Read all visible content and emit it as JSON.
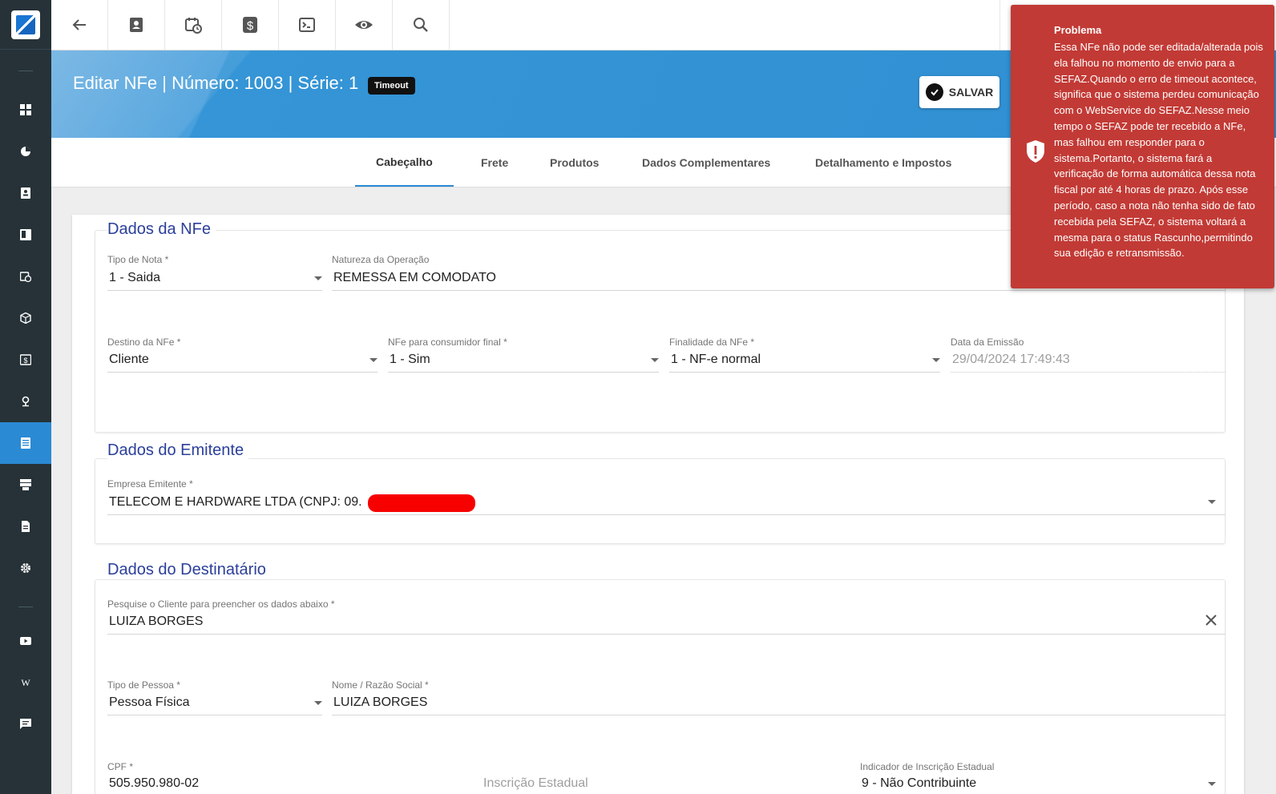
{
  "toolbar": {
    "buttons": [
      "back-arrow-icon",
      "contact-card-icon",
      "calendar-clock-icon",
      "dollar-icon",
      "terminal-icon",
      "eye-icon",
      "search-icon"
    ]
  },
  "header": {
    "title": "Editar NFe | Número: 1003 | Série: 1",
    "badge": "Timeout",
    "save_label": "SALVAR"
  },
  "tabs": [
    {
      "label": "Cabeçalho",
      "active": true
    },
    {
      "label": "Frete"
    },
    {
      "label": "Produtos"
    },
    {
      "label": "Dados Complementares"
    },
    {
      "label": "Detalhamento e Impostos"
    }
  ],
  "sections": {
    "nfe": {
      "title": "Dados da NFe",
      "tipo_nota": {
        "label": "Tipo de Nota *",
        "value": "1 - Saida"
      },
      "natureza": {
        "label": "Natureza da Operação",
        "value": "REMESSA EM COMODATO"
      },
      "destino": {
        "label": "Destino da NFe *",
        "value": "Cliente"
      },
      "consumidor": {
        "label": "NFe para consumidor final *",
        "value": "1 - Sim"
      },
      "finalidade": {
        "label": "Finalidade da NFe *",
        "value": "1 - NF-e normal"
      },
      "data_emissao": {
        "label": "Data da Emissão",
        "value": "29/04/2024 17:49:43"
      }
    },
    "emitente": {
      "title": "Dados do Emitente",
      "empresa": {
        "label": "Empresa Emitente *",
        "value": "TELECOM E HARDWARE LTDA (CNPJ: 09.",
        "value_end": ")"
      }
    },
    "destinatario": {
      "title": "Dados do Destinatário",
      "pesquisa": {
        "label": "Pesquise o Cliente para preencher os dados abaixo *",
        "value": "LUIZA BORGES"
      },
      "tipo_pessoa": {
        "label": "Tipo de Pessoa *",
        "value": "Pessoa Física"
      },
      "nome": {
        "label": "Nome / Razão Social *",
        "value": "LUIZA BORGES"
      },
      "cpf": {
        "label": "CPF *",
        "value": "505.950.980-02"
      },
      "inscricao": {
        "placeholder": "Inscrição Estadual"
      },
      "indicador": {
        "label": "Indicador de Inscrição Estadual",
        "value": "9 - Não Contribuinte"
      }
    }
  },
  "toast": {
    "title": "Problema",
    "message": "Essa NFe não pode ser editada/alterada pois ela falhou no momento de envio para a SEFAZ.Quando o erro de timeout acontece, significa que o sistema perdeu comunicação com o WebService do SEFAZ.Nesse meio tempo o SEFAZ pode ter recebido a NFe, mas falhou em responder para o sistema.Portanto, o sistema fará a verificação de forma automática dessa nota fiscal por até 4 horas de prazo. Após esse período, caso a nota não tenha sido de fato recebida pela SEFAZ, o sistema voltará a mesma para o status Rascunho,permitindo sua edição e retransmissão.",
    "color": "#c23a35"
  },
  "sidebar": {
    "items": [
      "dashboard-icon",
      "pie-chart-icon",
      "contact-icon",
      "board-icon",
      "calendar-icon",
      "package-icon",
      "money-icon",
      "location-icon",
      "document-icon",
      "server-icon",
      "file-icon",
      "settings-icon",
      "video-icon",
      "wiki-icon",
      "chat-icon"
    ],
    "active": "document-icon",
    "accent": "#2a8ad4"
  }
}
